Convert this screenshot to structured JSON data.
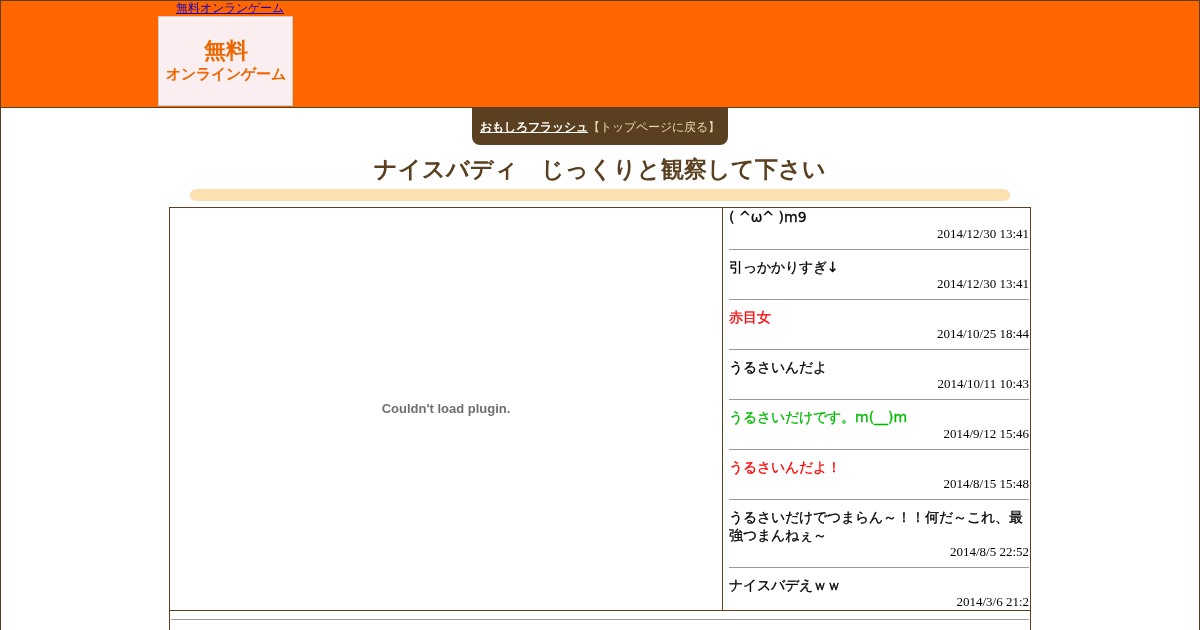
{
  "header": {
    "top_link": "無料オンランゲーム",
    "logo": {
      "line1": "無料",
      "line2": "オンラインゲーム"
    }
  },
  "nav": {
    "link": "おもしろフラッシュ",
    "text": "【トップページに戻る】"
  },
  "title": "ナイスバディ　じっくりと観察して下さい",
  "plugin_message": "Couldn't load plugin.",
  "comments": [
    {
      "text": "( ^ω^ )m9",
      "date": "2014/12/30 13:41",
      "color": "#000000"
    },
    {
      "text": "引っかかりすぎ↓",
      "date": "2014/12/30 13:41",
      "color": "#000000"
    },
    {
      "text": "赤目女",
      "date": "2014/10/25 18:44",
      "color": "#ff0000"
    },
    {
      "text": "うるさいんだよ",
      "date": "2014/10/11 10:43",
      "color": "#000000"
    },
    {
      "text": "うるさいだけです。m(__)m",
      "date": "2014/9/12 15:46",
      "color": "#00bb00"
    },
    {
      "text": "うるさいんだよ！",
      "date": "2014/8/15 15:48",
      "color": "#ff0000"
    },
    {
      "text": "うるさいだけでつまらん～！！何だ～これ、最強つまんねぇ～",
      "date": "2014/8/5 22:52",
      "color": "#000000"
    },
    {
      "text": "ナイスバデえｗｗ",
      "date": "2014/3/6 21:2",
      "color": "#000000"
    }
  ]
}
